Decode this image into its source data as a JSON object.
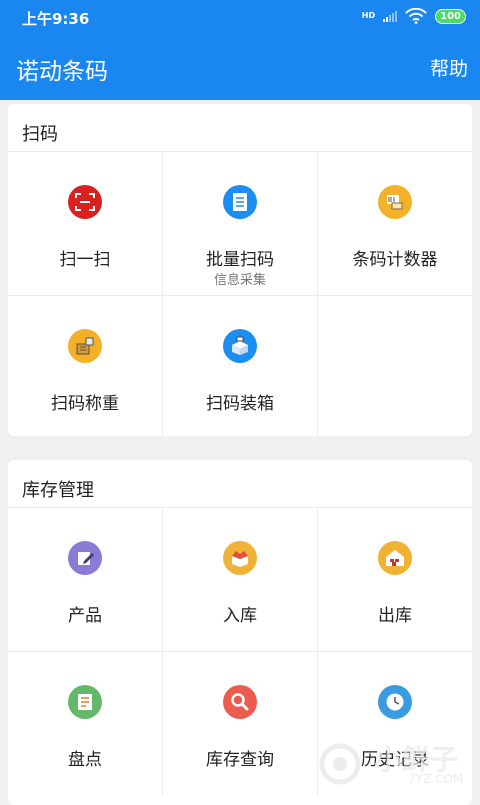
{
  "status": {
    "time": "上午9:36",
    "hd": "HD",
    "battery": "100"
  },
  "appbar": {
    "title": "诺动条码",
    "help": "帮助"
  },
  "sections": [
    {
      "title": "扫码",
      "items": [
        {
          "label": "扫一扫",
          "icon": "scan-frame-icon",
          "color": "#d9211f"
        },
        {
          "label": "批量扫码",
          "sub": "信息采集",
          "icon": "list-document-icon",
          "color": "#1c8ef0"
        },
        {
          "label": "条码计数器",
          "icon": "barcode-counter-icon",
          "color": "#f3b12a"
        },
        {
          "label": "扫码称重",
          "icon": "scale-weighing-icon",
          "color": "#f3b12a"
        },
        {
          "label": "扫码装箱",
          "icon": "box-packing-icon",
          "color": "#1c8ef0"
        }
      ]
    },
    {
      "title": "库存管理",
      "items": [
        {
          "label": "产品",
          "icon": "product-edit-icon",
          "color": "#8c7bd6"
        },
        {
          "label": "入库",
          "icon": "inbound-box-icon",
          "color": "#efb33a"
        },
        {
          "label": "出库",
          "icon": "outbound-warehouse-icon",
          "color": "#f0b232"
        },
        {
          "label": "盘点",
          "icon": "inventory-checklist-icon",
          "color": "#65b86a"
        },
        {
          "label": "库存查询",
          "icon": "search-magnifier-icon",
          "color": "#ec5b4e"
        },
        {
          "label": "历史记录",
          "icon": "history-clock-icon",
          "color": "#3a9be0"
        }
      ]
    }
  ],
  "watermark": {
    "text": "小鲜子",
    "sub": "7YZ.COM"
  }
}
